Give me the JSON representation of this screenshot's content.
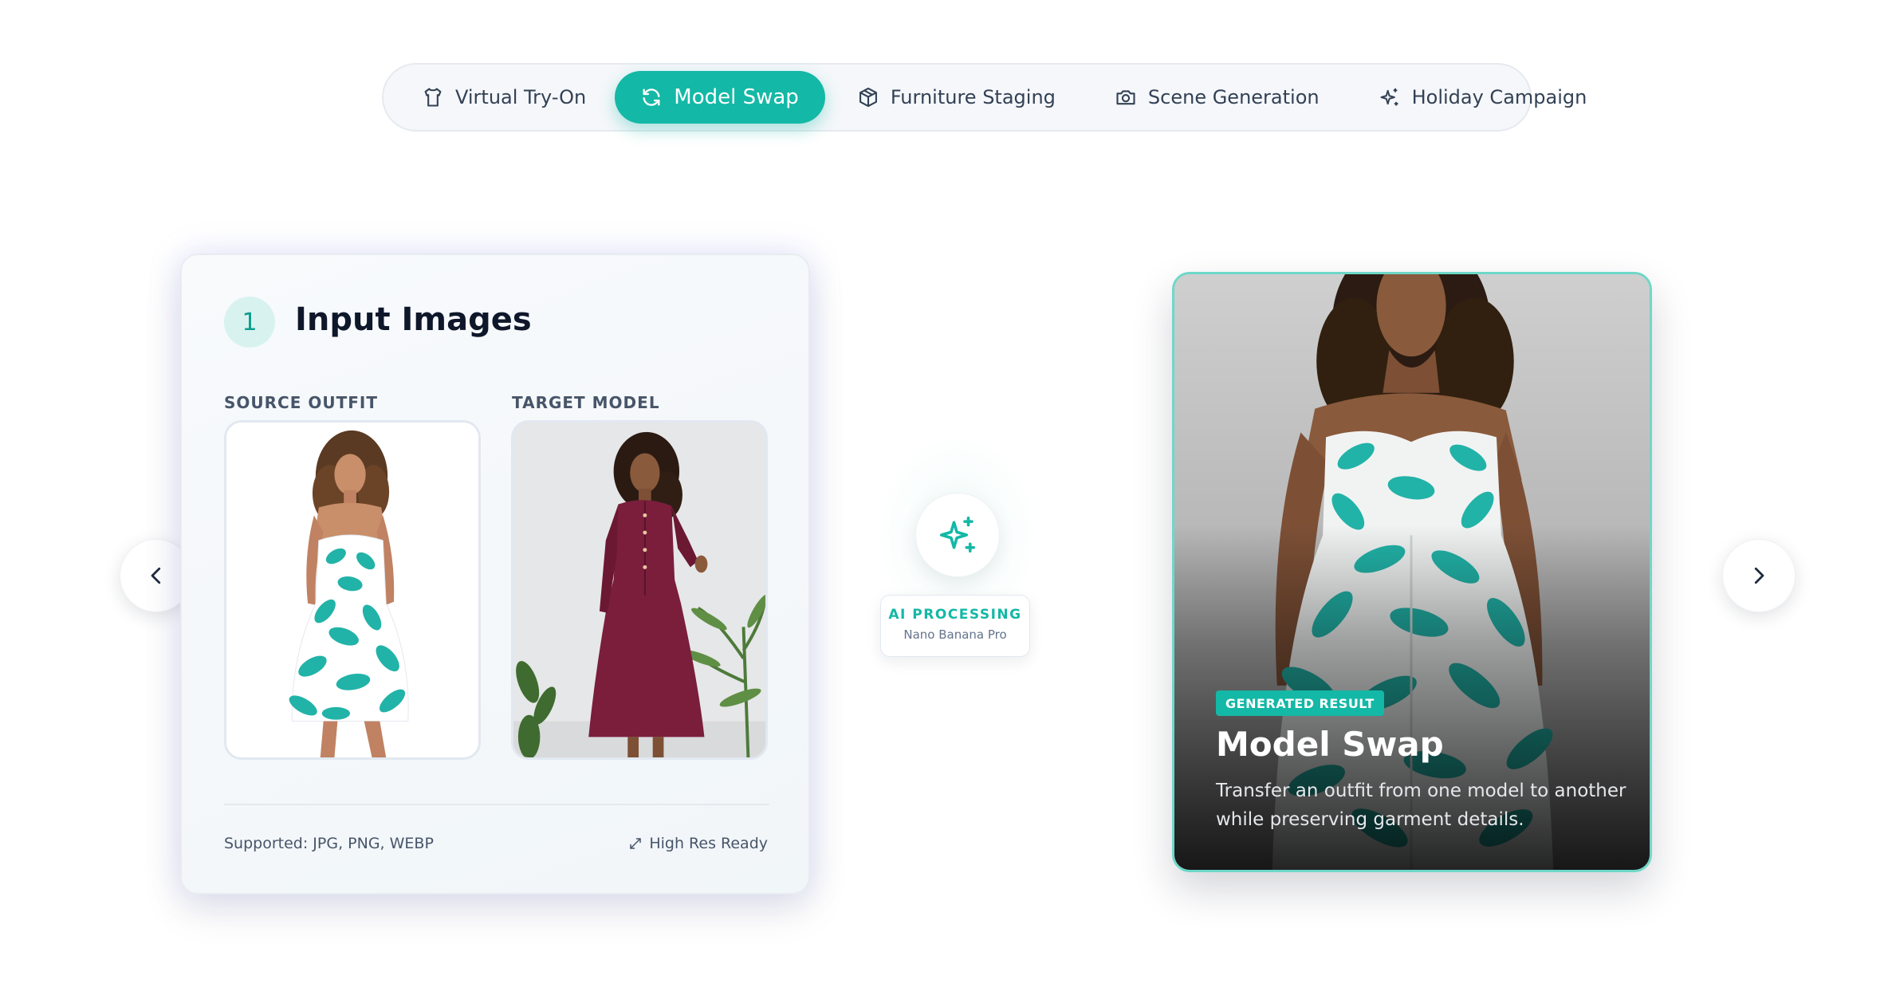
{
  "tabs": [
    {
      "label": "Virtual Try-On",
      "icon": "shirt-icon",
      "active": false
    },
    {
      "label": "Model Swap",
      "icon": "refresh-icon",
      "active": true
    },
    {
      "label": "Furniture Staging",
      "icon": "box-icon",
      "active": false
    },
    {
      "label": "Scene Generation",
      "icon": "camera-icon",
      "active": false
    },
    {
      "label": "Holiday Campaign",
      "icon": "sparkles-icon",
      "active": false
    }
  ],
  "input_card": {
    "step": "1",
    "title": "Input Images",
    "source_label": "SOURCE OUTFIT",
    "target_label": "TARGET MODEL",
    "supported": "Supported: JPG, PNG, WEBP",
    "high_res": "High Res Ready"
  },
  "processing": {
    "label": "AI PROCESSING",
    "model": "Nano Banana Pro"
  },
  "result": {
    "badge": "GENERATED RESULT",
    "title": "Model Swap",
    "description": "Transfer an outfit from one model to another while preserving garment details."
  },
  "colors": {
    "accent": "#14b8a6",
    "accent_light": "#d8f3ef",
    "result_border": "#6ed8c8",
    "dress_teal": "#22b3a8",
    "burgundy_dress": "#7a1e3c"
  }
}
